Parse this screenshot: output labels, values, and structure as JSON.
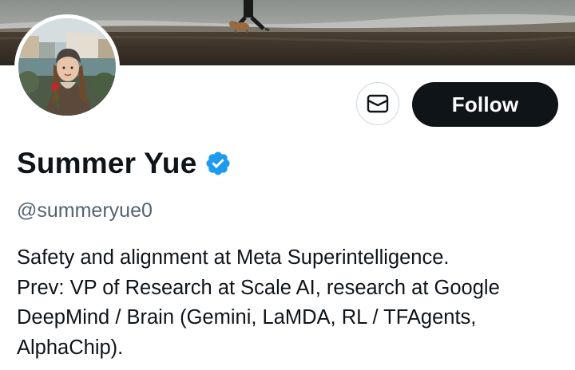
{
  "profile": {
    "display_name": "Summer Yue",
    "handle": "@summeryue0",
    "verified": true,
    "verified_icon": "verified-badge-icon",
    "bio_lines": [
      "Safety and alignment at Meta Superintelligence.",
      "Prev: VP of Research at Scale AI, research at Google",
      "DeepMind / Brain (Gemini, LaMDA, RL / TFAgents,",
      "AlphaChip)."
    ]
  },
  "actions": {
    "message_icon": "envelope-icon",
    "follow_label": "Follow"
  },
  "colors": {
    "text_primary": "#0f1419",
    "text_secondary": "#536471",
    "verified_blue": "#1d9bf0",
    "follow_bg": "#0f1419",
    "button_border": "#cfd9de"
  }
}
